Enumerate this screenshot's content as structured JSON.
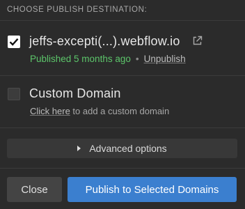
{
  "header": {
    "title": "CHOOSE PUBLISH DESTINATION:"
  },
  "destinations": [
    {
      "checked": true,
      "domain": "jeffs-excepti(...).webflow.io",
      "status": "Published 5 months ago",
      "separator": "•",
      "action_label": "Unpublish",
      "icons": [
        "checkbox-checked-icon",
        "external-link-icon"
      ]
    },
    {
      "checked": false,
      "domain": "Custom Domain",
      "link_label": "Click here",
      "link_suffix": "to add a custom domain",
      "icons": [
        "checkbox-unchecked-icon"
      ]
    }
  ],
  "advanced": {
    "label": "Advanced options",
    "icon": "caret-right-icon"
  },
  "footer": {
    "close_label": "Close",
    "publish_label": "Publish to Selected Domains"
  },
  "colors": {
    "background": "#2b2b2b",
    "published_green": "#5cc56a",
    "primary_button": "#3b7fcf",
    "secondary_button": "#444444"
  }
}
